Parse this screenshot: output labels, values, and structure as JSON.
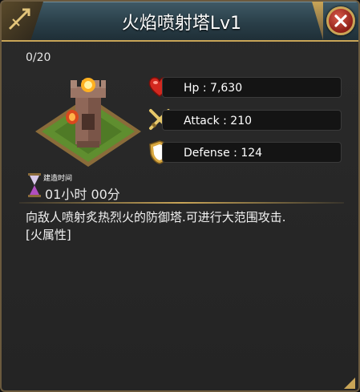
{
  "dialog": {
    "title": "火焰喷射塔Lv1",
    "counter": "0/20"
  },
  "stats": [
    {
      "label": "Hp : 7,630",
      "icon": "heart-icon"
    },
    {
      "label": "Attack : 210",
      "icon": "crossed-swords-icon"
    },
    {
      "label": "Defense : 124",
      "icon": "shield-icon"
    }
  ],
  "build": {
    "label": "建造时间",
    "time": "01小时 00分"
  },
  "description": {
    "line1": "向敌人喷射炙热烈火的防御塔.可进行大范围攻击.",
    "line2": "[火属性]"
  },
  "colors": {
    "header": "#2a3f49",
    "gold": "#c9a557",
    "panel": "#242424",
    "close": "#8e1f17"
  }
}
